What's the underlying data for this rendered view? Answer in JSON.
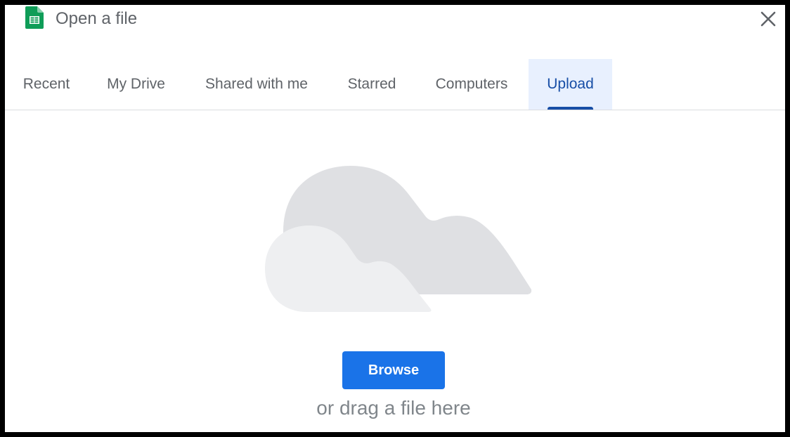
{
  "dialog": {
    "title": "Open a file",
    "app_icon": "google-sheets-icon",
    "close_icon": "close-icon"
  },
  "tabs": [
    {
      "label": "Recent",
      "active": false
    },
    {
      "label": "My Drive",
      "active": false
    },
    {
      "label": "Shared with me",
      "active": false
    },
    {
      "label": "Starred",
      "active": false
    },
    {
      "label": "Computers",
      "active": false
    },
    {
      "label": "Upload",
      "active": true
    }
  ],
  "upload": {
    "illustration": "cloud-illustration",
    "browse_label": "Browse",
    "drag_text": "or drag a file here"
  },
  "colors": {
    "accent": "#1a73e8",
    "active_tab_text": "#174ea6",
    "active_tab_bg": "#e8f0fe",
    "sheets_green": "#0f9d58"
  }
}
